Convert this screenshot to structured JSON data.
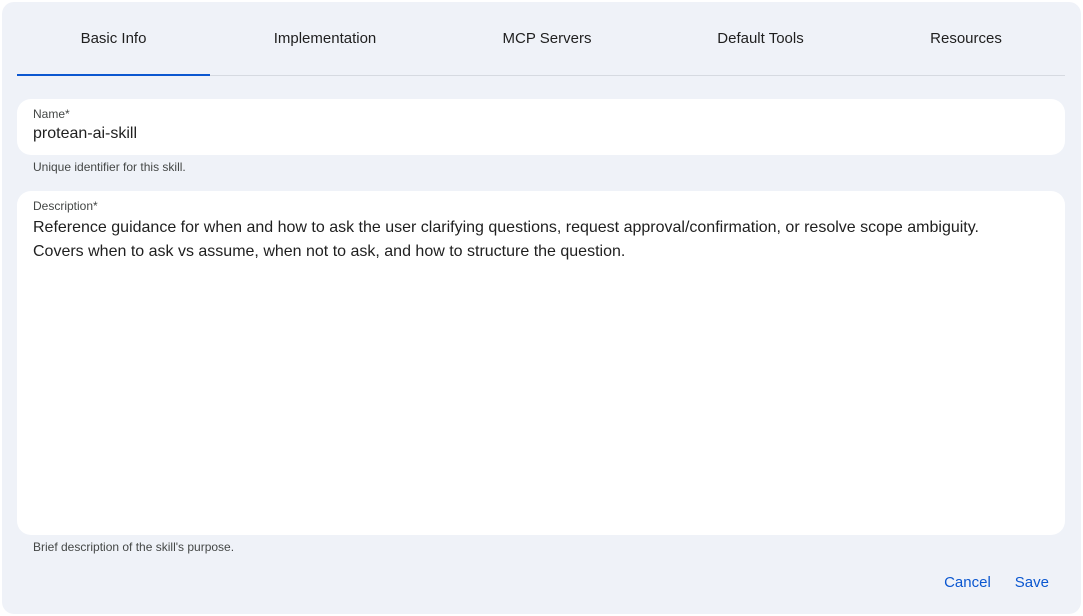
{
  "tabs": [
    {
      "label": "Basic Info",
      "active": true
    },
    {
      "label": "Implementation",
      "active": false
    },
    {
      "label": "MCP Servers",
      "active": false
    },
    {
      "label": "Default Tools",
      "active": false
    },
    {
      "label": "Resources",
      "active": false
    }
  ],
  "name_field": {
    "label": "Name*",
    "value": "protean-ai-skill",
    "hint": "Unique identifier for this skill."
  },
  "description_field": {
    "label": "Description*",
    "value": "Reference guidance for when and how to ask the user clarifying questions, request approval/confirmation, or resolve scope ambiguity.\nCovers when to ask vs assume, when not to ask, and how to structure the question.",
    "hint": "Brief description of the skill's purpose."
  },
  "actions": {
    "cancel_label": "Cancel",
    "save_label": "Save"
  },
  "colors": {
    "accent": "#0b57d0",
    "dialog_background": "#eff2f8",
    "field_background": "#ffffff"
  }
}
